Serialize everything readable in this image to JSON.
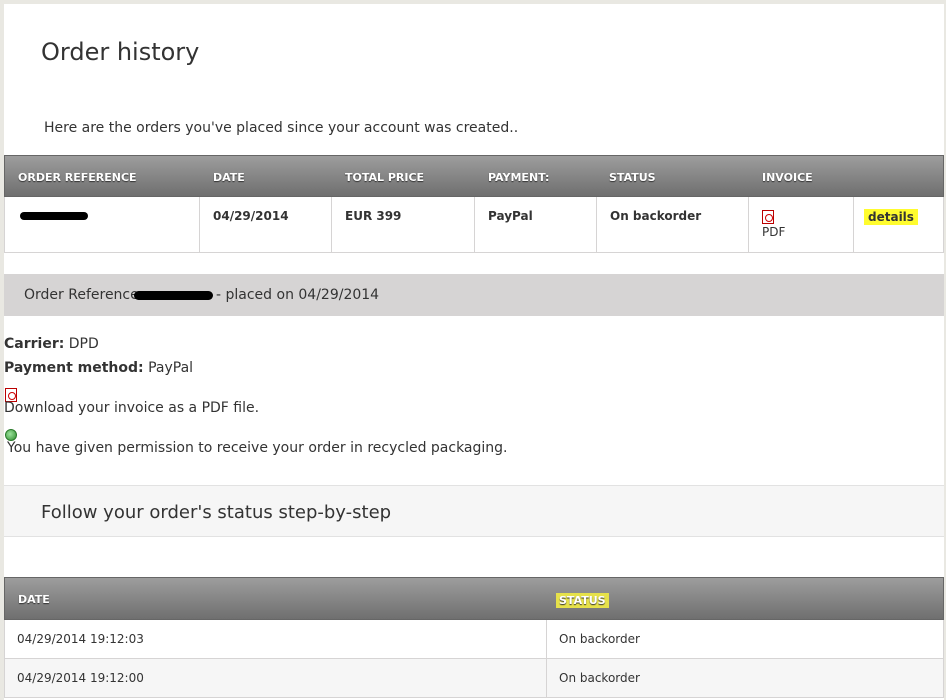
{
  "page": {
    "title": "Order history",
    "intro": "Here are the orders you've placed since your account was created.."
  },
  "orders_table": {
    "headers": [
      "ORDER REFERENCE",
      "DATE",
      "TOTAL PRICE",
      "PAYMENT:",
      "STATUS",
      "INVOICE"
    ],
    "row": {
      "date": "04/29/2014",
      "total": "EUR 399",
      "payment": "PayPal",
      "status": "On backorder",
      "invoice_label": "PDF",
      "details_label": "details"
    }
  },
  "order_detail": {
    "ref_prefix": "Order Reference",
    "ref_suffix": "- placed on 04/29/2014",
    "carrier_label": "Carrier:",
    "carrier_value": "DPD",
    "payment_label": "Payment method:",
    "payment_value": "PayPal",
    "invoice_text": "Download your invoice as a PDF file.",
    "recycled_text": "You have given permission to receive your order in recycled packaging."
  },
  "follow": {
    "title": "Follow your order's status step-by-step"
  },
  "status_table": {
    "headers": [
      "DATE",
      "STATUS"
    ],
    "rows": [
      {
        "date": "04/29/2014 19:12:03",
        "status": "On backorder"
      },
      {
        "date": "04/29/2014 19:12:00",
        "status": "On backorder"
      }
    ]
  },
  "colors": {
    "header_gradient_top": "#9d9d9d",
    "header_gradient_bottom": "#6f6f6f",
    "highlight": "#fffc2e",
    "bar_gray": "#d6d4d4"
  },
  "icons": [
    "pdf-icon",
    "recycle-icon"
  ]
}
